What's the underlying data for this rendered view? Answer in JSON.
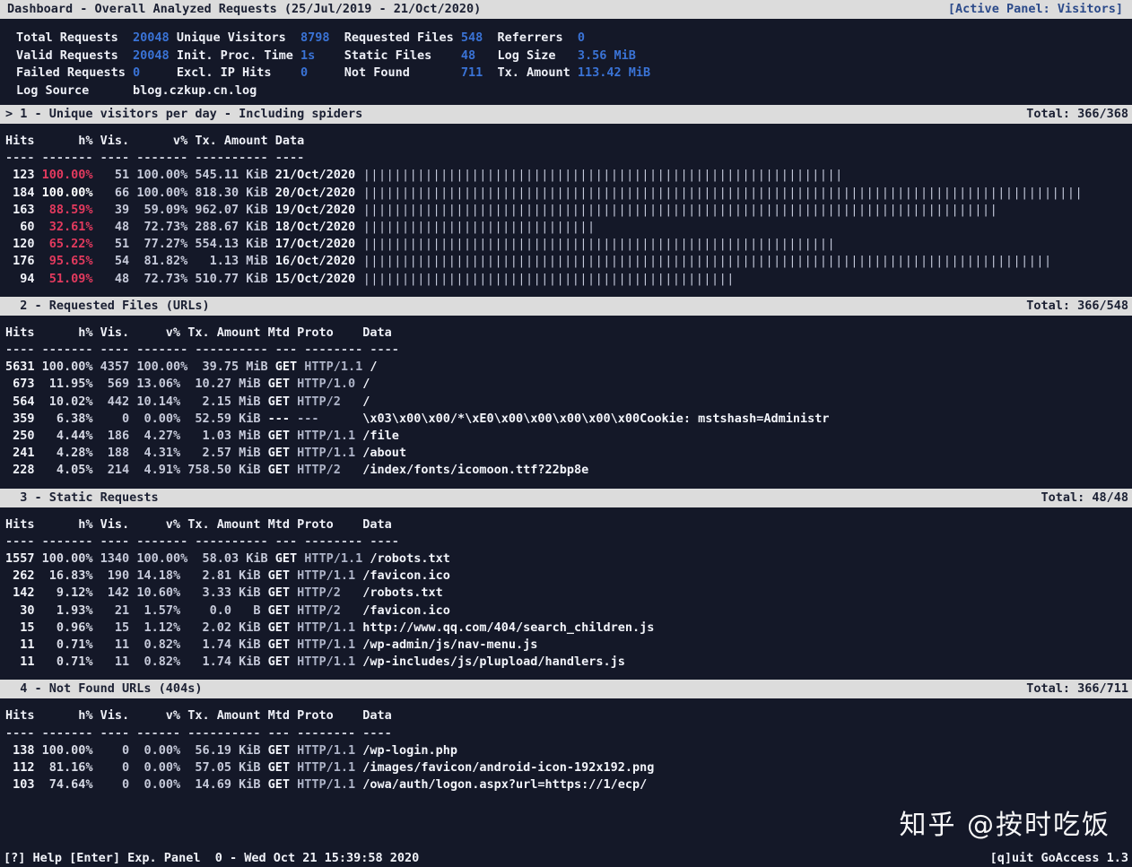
{
  "titlebar": {
    "title": "Dashboard - Overall Analyzed Requests (25/Jul/2019 - 21/Oct/2020)",
    "active_panel": "[Active Panel: Visitors]"
  },
  "colors": {
    "accent_blue": "#3a73d6",
    "accent_red": "#e33a5e",
    "bar_bg": "#dcdcdc",
    "terminal_bg": "#141828",
    "fg": "#e8eaf2"
  },
  "metrics": {
    "rows": [
      {
        "cells": [
          {
            "label": "Total Requests",
            "value": "20048"
          },
          {
            "label": "Unique Visitors",
            "value": "8798"
          },
          {
            "label": "Requested Files",
            "value": "548"
          },
          {
            "label": "Referrers",
            "value": "0"
          }
        ]
      },
      {
        "cells": [
          {
            "label": "Valid Requests",
            "value": "20048"
          },
          {
            "label": "Init. Proc. Time",
            "value": "1s"
          },
          {
            "label": "Static Files",
            "value": "48"
          },
          {
            "label": "Log Size",
            "value": "3.56 MiB"
          }
        ]
      },
      {
        "cells": [
          {
            "label": "Failed Requests",
            "value": "0"
          },
          {
            "label": "Excl. IP Hits",
            "value": "0"
          },
          {
            "label": "Not Found",
            "value": "711"
          },
          {
            "label": "Tx. Amount",
            "value": "113.42 MiB"
          }
        ]
      }
    ],
    "log_source_label": "Log Source",
    "log_source_value": "blog.czkup.cn.log"
  },
  "panels": [
    {
      "id": "panel-1-visitors",
      "marker": "> ",
      "title": "1 - Unique visitors per day - Including spiders",
      "total": "Total: 366/368",
      "columns": [
        "Hits",
        "h%",
        "Vis.",
        "v%",
        "Tx. Amount",
        "Data"
      ],
      "dashes": "---- ------- ---- ------- ---------- ----",
      "has_bars": true,
      "max_hits": 184,
      "rows": [
        {
          "hits": "123",
          "hpct": "100.00%",
          "hpct_color": "red",
          "vis": "51",
          "vpct": "100.00%",
          "tx": "545.11 KiB",
          "data": "21/Oct/2020",
          "bar_hits": 123
        },
        {
          "hits": "184",
          "hpct": "100.00%",
          "hpct_color": "white",
          "vis": "66",
          "vpct": "100.00%",
          "tx": "818.30 KiB",
          "data": "20/Oct/2020",
          "bar_hits": 184
        },
        {
          "hits": "163",
          "hpct": "88.59%",
          "hpct_color": "red",
          "vis": "39",
          "vpct": "59.09%",
          "tx": "962.07 KiB",
          "data": "19/Oct/2020",
          "bar_hits": 163
        },
        {
          "hits": "60",
          "hpct": "32.61%",
          "hpct_color": "red",
          "vis": "48",
          "vpct": "72.73%",
          "tx": "288.67 KiB",
          "data": "18/Oct/2020",
          "bar_hits": 60
        },
        {
          "hits": "120",
          "hpct": "65.22%",
          "hpct_color": "red",
          "vis": "51",
          "vpct": "77.27%",
          "tx": "554.13 KiB",
          "data": "17/Oct/2020",
          "bar_hits": 120
        },
        {
          "hits": "176",
          "hpct": "95.65%",
          "hpct_color": "red",
          "vis": "54",
          "vpct": "81.82%",
          "tx": "1.13 MiB",
          "data": "16/Oct/2020",
          "bar_hits": 176
        },
        {
          "hits": "94",
          "hpct": "51.09%",
          "hpct_color": "red",
          "vis": "48",
          "vpct": "72.73%",
          "tx": "510.77 KiB",
          "data": "15/Oct/2020",
          "bar_hits": 94
        }
      ]
    },
    {
      "id": "panel-2-requested-files",
      "marker": "  ",
      "title": "2 - Requested Files (URLs)",
      "total": "Total: 366/548",
      "columns": [
        "Hits",
        "h%",
        "Vis.",
        "v%",
        "Tx. Amount",
        "Mtd",
        "Proto",
        "Data"
      ],
      "dashes": "---- ------- ---- ------- ---------- --- -------- ----",
      "has_bars": false,
      "rows": [
        {
          "hits": "5631",
          "hpct": "100.00%",
          "hpct_color": "plain",
          "vis": "4357",
          "vpct": "100.00%",
          "tx": "39.75 MiB",
          "mtd": "GET",
          "proto": "HTTP/1.1",
          "data": "/"
        },
        {
          "hits": "673",
          "hpct": "11.95%",
          "hpct_color": "plain",
          "vis": "569",
          "vpct": "13.06%",
          "tx": "10.27 MiB",
          "mtd": "GET",
          "proto": "HTTP/1.0",
          "data": "/"
        },
        {
          "hits": "564",
          "hpct": "10.02%",
          "hpct_color": "plain",
          "vis": "442",
          "vpct": "10.14%",
          "tx": "2.15 MiB",
          "mtd": "GET",
          "proto": "HTTP/2",
          "data": "/"
        },
        {
          "hits": "359",
          "hpct": "6.38%",
          "hpct_color": "plain",
          "vis": "0",
          "vpct": "0.00%",
          "tx": "52.59 KiB",
          "mtd": "---",
          "proto": "---",
          "data": "\\x03\\x00\\x00/*\\xE0\\x00\\x00\\x00\\x00\\x00Cookie: mstshash=Administr"
        },
        {
          "hits": "250",
          "hpct": "4.44%",
          "hpct_color": "plain",
          "vis": "186",
          "vpct": "4.27%",
          "tx": "1.03 MiB",
          "mtd": "GET",
          "proto": "HTTP/1.1",
          "data": "/file"
        },
        {
          "hits": "241",
          "hpct": "4.28%",
          "hpct_color": "plain",
          "vis": "188",
          "vpct": "4.31%",
          "tx": "2.57 MiB",
          "mtd": "GET",
          "proto": "HTTP/1.1",
          "data": "/about"
        },
        {
          "hits": "228",
          "hpct": "4.05%",
          "hpct_color": "plain",
          "vis": "214",
          "vpct": "4.91%",
          "tx": "758.50 KiB",
          "mtd": "GET",
          "proto": "HTTP/2",
          "data": "/index/fonts/icomoon.ttf?22bp8e"
        }
      ]
    },
    {
      "id": "panel-3-static-requests",
      "marker": "  ",
      "title": "3 - Static Requests",
      "total": "Total: 48/48",
      "columns": [
        "Hits",
        "h%",
        "Vis.",
        "v%",
        "Tx. Amount",
        "Mtd",
        "Proto",
        "Data"
      ],
      "dashes": "---- ------- ---- ------- ---------- --- -------- ----",
      "has_bars": false,
      "rows": [
        {
          "hits": "1557",
          "hpct": "100.00%",
          "hpct_color": "plain",
          "vis": "1340",
          "vpct": "100.00%",
          "tx": "58.03 KiB",
          "mtd": "GET",
          "proto": "HTTP/1.1",
          "data": "/robots.txt"
        },
        {
          "hits": "262",
          "hpct": "16.83%",
          "hpct_color": "plain",
          "vis": "190",
          "vpct": "14.18%",
          "tx": "2.81 KiB",
          "mtd": "GET",
          "proto": "HTTP/1.1",
          "data": "/favicon.ico"
        },
        {
          "hits": "142",
          "hpct": "9.12%",
          "hpct_color": "plain",
          "vis": "142",
          "vpct": "10.60%",
          "tx": "3.33 KiB",
          "mtd": "GET",
          "proto": "HTTP/2",
          "data": "/robots.txt"
        },
        {
          "hits": "30",
          "hpct": "1.93%",
          "hpct_color": "plain",
          "vis": "21",
          "vpct": "1.57%",
          "tx": "0.0   B",
          "mtd": "GET",
          "proto": "HTTP/2",
          "data": "/favicon.ico"
        },
        {
          "hits": "15",
          "hpct": "0.96%",
          "hpct_color": "plain",
          "vis": "15",
          "vpct": "1.12%",
          "tx": "2.02 KiB",
          "mtd": "GET",
          "proto": "HTTP/1.1",
          "data": "http://www.qq.com/404/search_children.js"
        },
        {
          "hits": "11",
          "hpct": "0.71%",
          "hpct_color": "plain",
          "vis": "11",
          "vpct": "0.82%",
          "tx": "1.74 KiB",
          "mtd": "GET",
          "proto": "HTTP/1.1",
          "data": "/wp-admin/js/nav-menu.js"
        },
        {
          "hits": "11",
          "hpct": "0.71%",
          "hpct_color": "plain",
          "vis": "11",
          "vpct": "0.82%",
          "tx": "1.74 KiB",
          "mtd": "GET",
          "proto": "HTTP/1.1",
          "data": "/wp-includes/js/plupload/handlers.js"
        }
      ]
    },
    {
      "id": "panel-4-not-found",
      "marker": "  ",
      "title": "4 - Not Found URLs (404s)",
      "total": "Total: 366/711",
      "columns": [
        "Hits",
        "h%",
        "Vis.",
        "v%",
        "Tx. Amount",
        "Mtd",
        "Proto",
        "Data"
      ],
      "dashes": "---- ------- ---- ------ ---------- --- -------- ----",
      "has_bars": false,
      "rows": [
        {
          "hits": "138",
          "hpct": "100.00%",
          "hpct_color": "plain",
          "vis": "0",
          "vpct": "0.00%",
          "tx": "56.19 KiB",
          "mtd": "GET",
          "proto": "HTTP/1.1",
          "data": "/wp-login.php"
        },
        {
          "hits": "112",
          "hpct": "81.16%",
          "hpct_color": "plain",
          "vis": "0",
          "vpct": "0.00%",
          "tx": "57.05 KiB",
          "mtd": "GET",
          "proto": "HTTP/1.1",
          "data": "/images/favicon/android-icon-192x192.png"
        },
        {
          "hits": "103",
          "hpct": "74.64%",
          "hpct_color": "plain",
          "vis": "0",
          "vpct": "0.00%",
          "tx": "14.69 KiB",
          "mtd": "GET",
          "proto": "HTTP/1.1",
          "data": "/owa/auth/logon.aspx?url=https://1/ecp/"
        }
      ]
    }
  ],
  "statusbar": {
    "left": "[?] Help [Enter] Exp. Panel  0 - Wed Oct 21 15:39:58 2020",
    "right": "[q]uit GoAccess 1.3"
  },
  "watermark": "知乎 @按时吃饭"
}
